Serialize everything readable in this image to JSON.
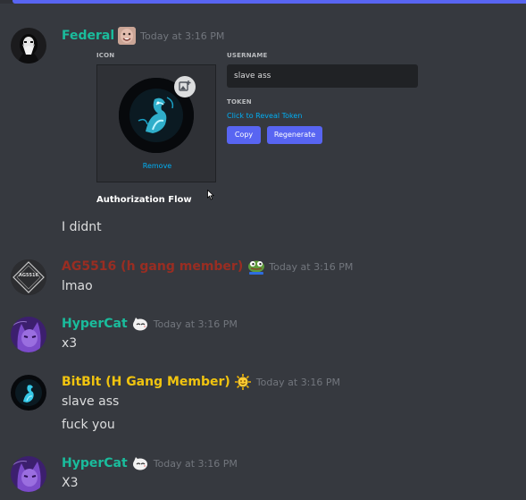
{
  "colors": {
    "background": "#36393f",
    "accent": "#5865f2",
    "link": "#00aff4",
    "timestamp": "#72767d"
  },
  "messages": [
    {
      "author": "Federal",
      "author_color": "#1abc9c",
      "badge": "face-emoji",
      "timestamp": "Today at 3:16 PM",
      "embed": {
        "icon_label": "ICON",
        "remove_label": "Remove",
        "username_label": "USERNAME",
        "username_value": "slave ass",
        "token_label": "TOKEN",
        "reveal_label": "Click to Reveal Token",
        "copy_label": "Copy",
        "regenerate_label": "Regenerate",
        "auth_flow_label": "Authorization Flow"
      },
      "lines": [
        "I didnt"
      ]
    },
    {
      "author": "AG5516 (h gang member)",
      "author_color": "#992d22",
      "avatar_text": "AG5516",
      "badge": "pepe-emoji",
      "timestamp": "Today at 3:16 PM",
      "lines": [
        "lmao"
      ]
    },
    {
      "author": "HyperCat",
      "author_color": "#1abc9c",
      "badge": "cat-emoji",
      "timestamp": "Today at 3:16 PM",
      "lines": [
        "x3"
      ]
    },
    {
      "author": "BitBlt (H Gang Member)",
      "author_color": "#f1c40f",
      "badge": "sun-emoji",
      "timestamp": "Today at 3:16 PM",
      "lines": [
        "slave ass",
        "fuck you"
      ]
    },
    {
      "author": "HyperCat",
      "author_color": "#1abc9c",
      "badge": "cat-emoji",
      "timestamp": "Today at 3:16 PM",
      "lines": [
        "X3"
      ]
    }
  ]
}
